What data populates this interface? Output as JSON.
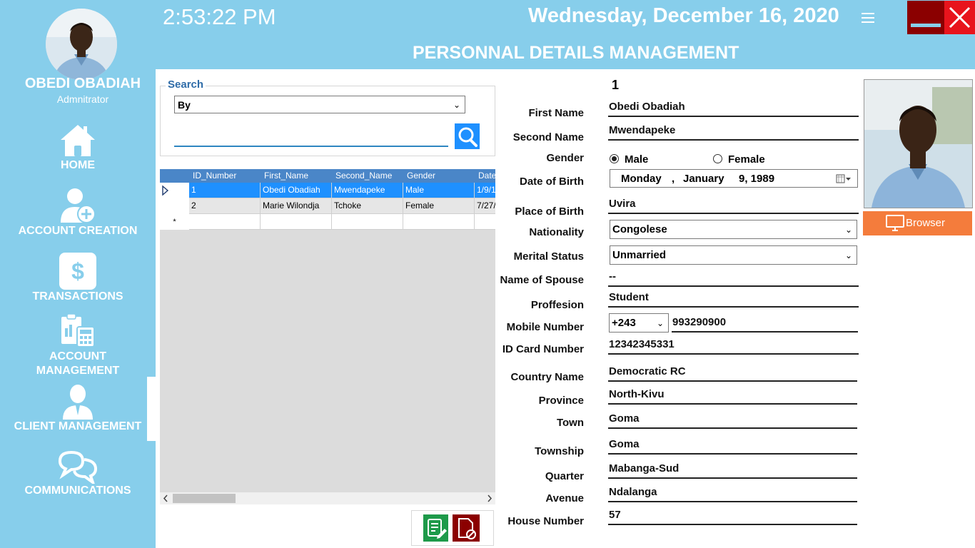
{
  "user": {
    "name": "OBEDI OBADIAH",
    "role": "Admnitrator"
  },
  "nav": [
    {
      "label": "HOME"
    },
    {
      "label": "ACCOUNT CREATION"
    },
    {
      "label": "TRANSACTIONS"
    },
    {
      "label": "ACCOUNT MANAGEMENT"
    },
    {
      "label": "CLIENT MANAGEMENT"
    },
    {
      "label": "COMMUNICATIONS"
    }
  ],
  "header": {
    "time": "2:53:22 PM",
    "date": "Wednesday, December 16, 2020",
    "title": "PERSONNAL DETAILS MANAGEMENT"
  },
  "search": {
    "legend": "Search",
    "by": "By",
    "value": ""
  },
  "grid": {
    "columns": [
      "ID_Number",
      "First_Name",
      "Second_Name",
      "Gender",
      "Date"
    ],
    "rows": [
      [
        "1",
        "Obedi Obadiah",
        "Mwendapeke",
        "Male",
        "1/9/1"
      ],
      [
        "2",
        "Marie Wilondja",
        "Tchoke",
        "Female",
        "7/27/"
      ]
    ],
    "new_row_marker": "*"
  },
  "form": {
    "id": "1",
    "labels": {
      "first_name": "First Name",
      "second_name": "Second Name",
      "gender": "Gender",
      "dob": "Date of Birth",
      "pob": "Place of Birth",
      "nationality": "Nationality",
      "marital": "Merital Status",
      "spouse": "Name of Spouse",
      "profession": "Proffesion",
      "mobile": "Mobile Number",
      "idcard": "ID Card Number",
      "country": "Country Name",
      "province": "Province",
      "town": "Town",
      "township": "Township",
      "quarter": "Quarter",
      "avenue": "Avenue",
      "house": "House Number"
    },
    "values": {
      "first_name": "Obedi Obadiah",
      "second_name": "Mwendapeke",
      "gender_male": "Male",
      "gender_female": "Female",
      "dob_day": "Monday",
      "dob_sep": ",",
      "dob_month": "January",
      "dob_dayyear": "9, 1989",
      "pob": "Uvira",
      "nationality": "Congolese",
      "marital": "Unmarried",
      "spouse": "--",
      "profession": "Student",
      "mobile_code": "+243",
      "mobile": "993290900",
      "idcard": "12342345331",
      "country": "Democratic RC",
      "province": "North-Kivu",
      "town": "Goma",
      "township": "Goma",
      "quarter": "Mabanga-Sud",
      "avenue": "Ndalanga",
      "house": "57"
    },
    "gender_selected": "Male"
  },
  "browse_label": "Browser",
  "colors": {
    "sidebar": "#87ceeb",
    "grid_header": "#4a86c8",
    "selected_row": "#1e90ff",
    "browse": "#f47c3c",
    "close": "#e8141c",
    "minimize": "#8b0000"
  }
}
